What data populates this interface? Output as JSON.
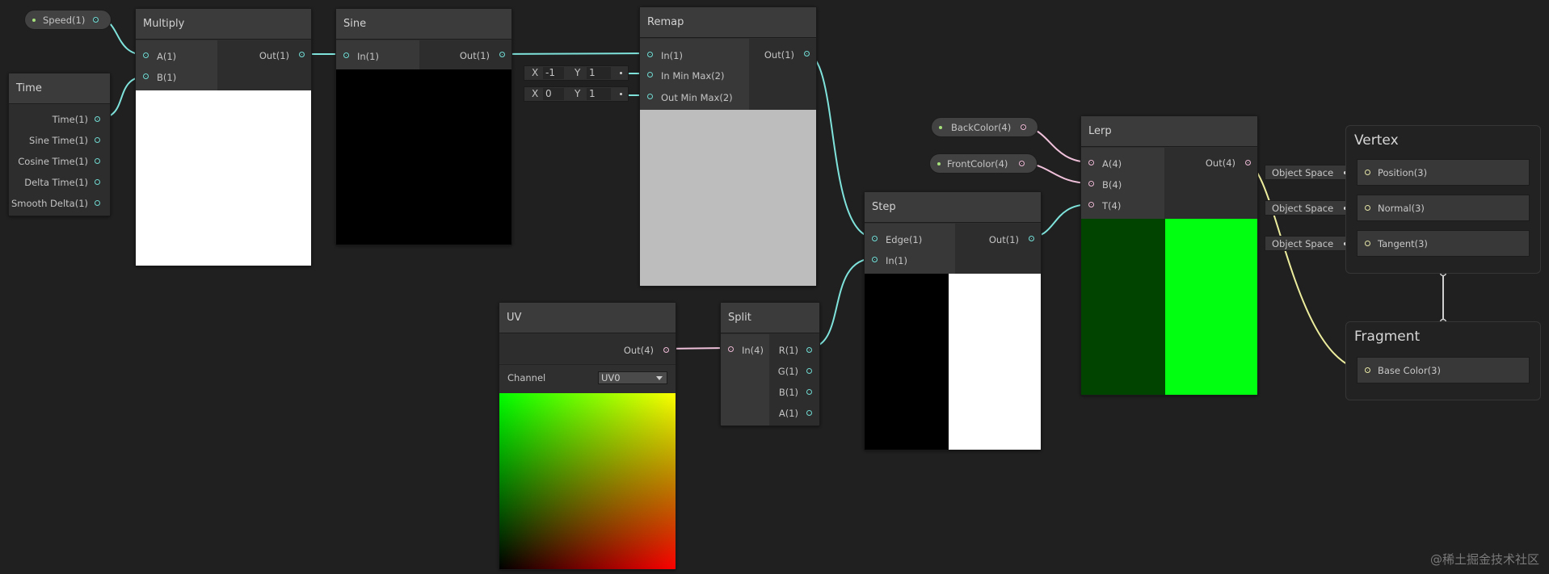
{
  "properties": {
    "speed": "Speed(1)",
    "back_color": "BackColor(4)",
    "front_color": "FrontColor(4)"
  },
  "nodes": {
    "time": {
      "title": "Time",
      "outputs": [
        "Time(1)",
        "Sine Time(1)",
        "Cosine Time(1)",
        "Delta Time(1)",
        "Smooth Delta(1)"
      ]
    },
    "multiply": {
      "title": "Multiply",
      "inputs": [
        "A(1)",
        "B(1)"
      ],
      "output": "Out(1)"
    },
    "sine": {
      "title": "Sine",
      "input": "In(1)",
      "output": "Out(1)"
    },
    "remap": {
      "title": "Remap",
      "inputs": [
        "In(1)",
        "In Min Max(2)",
        "Out Min Max(2)"
      ],
      "output": "Out(1)",
      "in_min_max": {
        "x_label": "X",
        "x": "-1",
        "y_label": "Y",
        "y": "1"
      },
      "out_min_max": {
        "x_label": "X",
        "x": "0",
        "y_label": "Y",
        "y": "1"
      }
    },
    "uv": {
      "title": "UV",
      "output": "Out(4)",
      "channel_label": "Channel",
      "channel_value": "UV0"
    },
    "split": {
      "title": "Split",
      "input": "In(4)",
      "outputs": [
        "R(1)",
        "G(1)",
        "B(1)",
        "A(1)"
      ]
    },
    "step": {
      "title": "Step",
      "inputs": [
        "Edge(1)",
        "In(1)"
      ],
      "output": "Out(1)"
    },
    "lerp": {
      "title": "Lerp",
      "inputs": [
        "A(4)",
        "B(4)",
        "T(4)"
      ],
      "output": "Out(4)"
    }
  },
  "master": {
    "vertex": {
      "title": "Vertex",
      "slots": [
        "Position(3)",
        "Normal(3)",
        "Tangent(3)"
      ],
      "space_tags": [
        "Object Space",
        "Object Space",
        "Object Space"
      ]
    },
    "fragment": {
      "title": "Fragment",
      "slots": [
        "Base Color(3)"
      ]
    }
  },
  "watermark": "@稀土掘金技术社区",
  "colors": {
    "background": "#202020",
    "wire_float": "#7fe3dc",
    "wire_vector4": "#f0c1da",
    "wire_vector3": "#eded9e",
    "lerp_back": "#004400",
    "lerp_front": "#00ff11"
  }
}
